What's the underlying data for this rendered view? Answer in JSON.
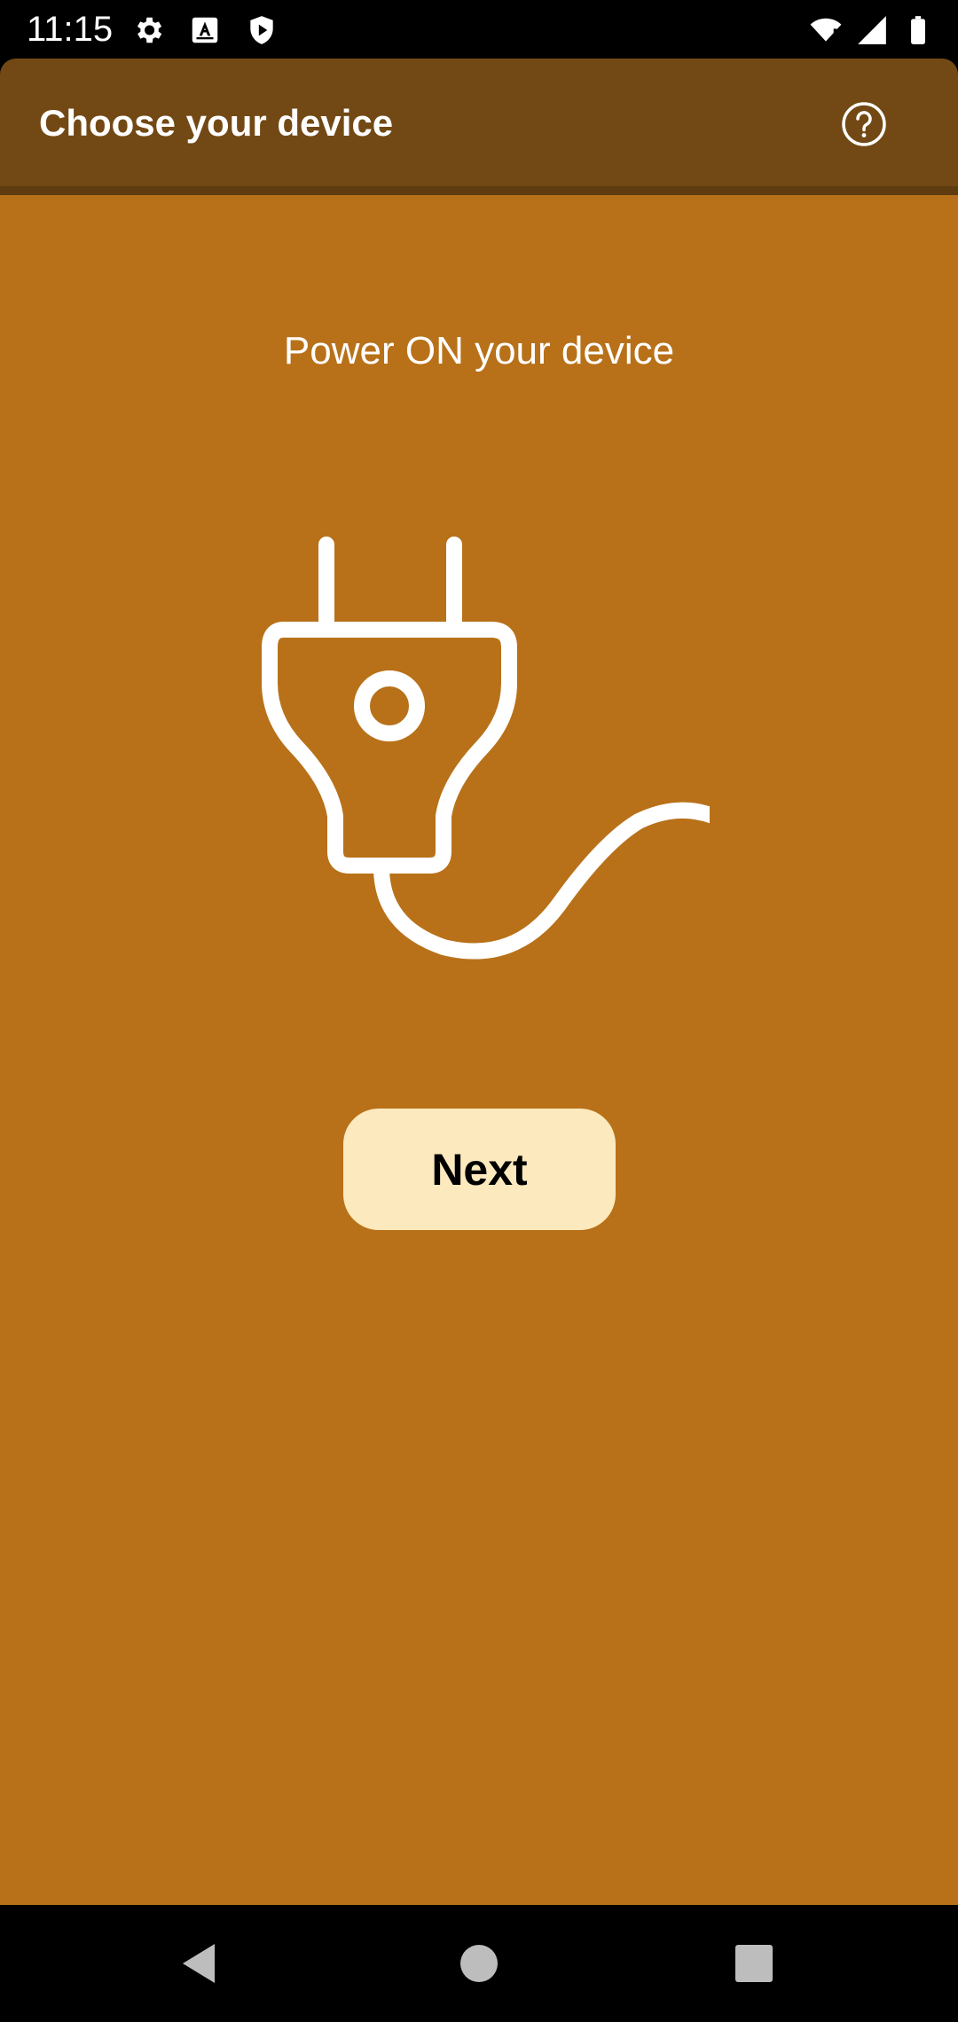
{
  "status_bar": {
    "time": "11:15",
    "icons_left": [
      "settings-icon",
      "a-box-icon",
      "play-shield-icon"
    ],
    "icons_right": [
      "wifi-alert-icon",
      "cell-signal-icon",
      "battery-icon"
    ]
  },
  "app_bar": {
    "title": "Choose your device",
    "help_icon": "help-circle-icon"
  },
  "content": {
    "instruction": "Power ON your device",
    "illustration_icon": "power-plug-icon",
    "next_label": "Next"
  },
  "nav_bar": {
    "back_icon": "back-triangle-icon",
    "home_icon": "home-circle-icon",
    "recents_icon": "recents-square-icon"
  },
  "colors": {
    "app_bar": "#724915",
    "background": "#b87119",
    "button": "#fce9bd",
    "text_on_background": "#ffffff"
  }
}
